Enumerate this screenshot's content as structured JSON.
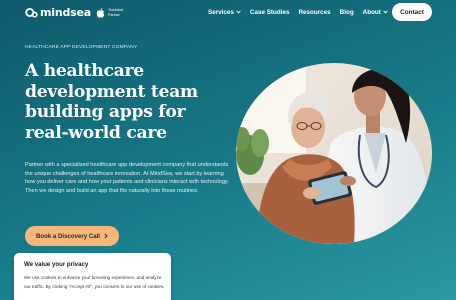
{
  "brand": {
    "logo_text": "mindsea",
    "badge_line1": "Technical",
    "badge_line2": "Partner"
  },
  "nav": {
    "items": [
      {
        "label": "Services",
        "dropdown": true
      },
      {
        "label": "Case Studies",
        "dropdown": false
      },
      {
        "label": "Resources",
        "dropdown": false
      },
      {
        "label": "Blog",
        "dropdown": false
      },
      {
        "label": "About",
        "dropdown": true
      }
    ],
    "contact_label": "Contact"
  },
  "hero": {
    "eyebrow": "HEALTHCARE APP DEVELOPMENT COMPANY",
    "headline_lines": [
      "A healthcare",
      "development team",
      "building apps for",
      "real-world care"
    ],
    "body": "Partner with a specialized healthcare app development company that understands the unique challenges of healthcare innovation. At MindSea, we start by learning how you deliver care and how your patients and clinicians interact with technology. Then we design and build an app that fits naturally into those routines.",
    "cta_label": "Book a Discovery Call",
    "cta_icon": "chevron-right-icon"
  },
  "cookie": {
    "title": "We value your privacy",
    "text": "We use cookies to enhance your browsing experience, and analyze our traffic. By clicking \"Accept All\", you consent to our use of cookies."
  },
  "colors": {
    "background": "#187a88",
    "cta": "#f7b67a",
    "contact_bg": "#ffffff",
    "text": "#ffffff"
  }
}
